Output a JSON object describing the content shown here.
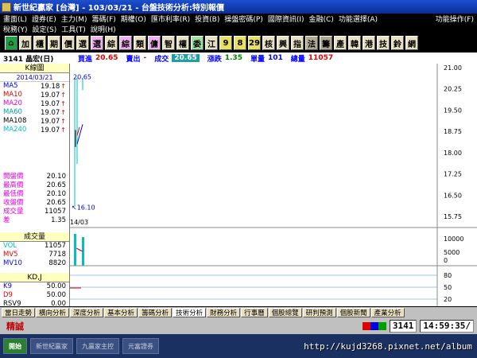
{
  "window": {
    "title": "新世紀贏家 [台灣] - 103/03/21 - 台盤技術分析:特別報價"
  },
  "menu": {
    "row1": [
      "畫面(L)",
      "證券(E)",
      "主力(M)",
      "籌碼(F)",
      "期權(O)",
      "匯市利率(R)",
      "投資(B)",
      "操盤密碼(P)",
      "國際資訊(I)",
      "金融(C)",
      "功能選擇(A)"
    ],
    "row1_right": "功能操作(F)",
    "row2": [
      "稅務(Y)",
      "設定(S)",
      "工具(T)",
      "說明(H)"
    ]
  },
  "toolbar": {
    "buttons": [
      {
        "label": "⌂",
        "style": "home"
      },
      {
        "label": "加",
        "style": ""
      },
      {
        "label": "櫃",
        "style": ""
      },
      {
        "label": "期",
        "style": ""
      },
      {
        "label": "價",
        "style": ""
      },
      {
        "label": "選",
        "style": ""
      },
      {
        "label": "選",
        "style": "pink"
      },
      {
        "label": "綜",
        "style": ""
      },
      {
        "label": "綜",
        "style": "pink"
      },
      {
        "label": "類",
        "style": ""
      },
      {
        "label": "傭",
        "style": "pink"
      },
      {
        "label": "智",
        "style": ""
      },
      {
        "label": "權",
        "style": ""
      },
      {
        "label": "委",
        "style": "green"
      },
      {
        "label": "江",
        "style": ""
      },
      {
        "label": "9",
        "style": "yellow"
      },
      {
        "label": "8",
        "style": "yellow"
      },
      {
        "label": "29",
        "style": "yellow"
      },
      {
        "label": "核",
        "style": ""
      },
      {
        "label": "興",
        "style": ""
      },
      {
        "label": "指",
        "style": ""
      },
      {
        "label": "法",
        "style": "gray"
      },
      {
        "label": "籌",
        "style": "gray"
      },
      {
        "label": "產",
        "style": ""
      },
      {
        "label": "韓",
        "style": ""
      },
      {
        "label": "港",
        "style": ""
      },
      {
        "label": "技",
        "style": ""
      },
      {
        "label": "鈴",
        "style": ""
      },
      {
        "label": "網",
        "style": ""
      }
    ]
  },
  "quote": {
    "symbol": "3141 晶宏(日)",
    "buy_label": "買進",
    "buy_value": "20.65",
    "sell_label": "賣出",
    "sell_value": "-",
    "deal_label": "成交",
    "deal_value": "20.65",
    "change_label": "漲跌",
    "change_value": "1.35",
    "volume_label": "單量",
    "volume_value": "101",
    "total_label": "總量",
    "total_value": "11057"
  },
  "side": {
    "kline_title": "K線圖",
    "date": "2014/03/21",
    "ma": [
      {
        "label": "MA5",
        "value": "19.18",
        "color": "#0000ff"
      },
      {
        "label": "MA10",
        "value": "19.07",
        "color": "#e00000"
      },
      {
        "label": "MA20",
        "value": "19.07",
        "color": "#e000e0"
      },
      {
        "label": "MA60",
        "value": "19.07",
        "color": "#00a0a0"
      },
      {
        "label": "MA108",
        "value": "19.07",
        "color": "#000000"
      },
      {
        "label": "MA240",
        "value": "19.07",
        "color": "#00c0c0"
      }
    ],
    "prices": [
      {
        "label": "開盤價",
        "value": "20.10"
      },
      {
        "label": "最高價",
        "value": "20.65"
      },
      {
        "label": "最低價",
        "value": "20.10"
      },
      {
        "label": "收盤價",
        "value": "20.65"
      },
      {
        "label": "成交量",
        "value": "11057"
      },
      {
        "label": "差",
        "value": "1.35"
      }
    ],
    "vol_title": "成交量",
    "vol": [
      {
        "label": "VOL",
        "value": "11057",
        "color": "#00c0c0"
      },
      {
        "label": "MV5",
        "value": "7718",
        "color": "#e00000"
      },
      {
        "label": "MV10",
        "value": "8820",
        "color": "#0000ff"
      }
    ],
    "kd_title": "KD,J",
    "kd": [
      {
        "label": "K9",
        "value": "50.00",
        "color": "#0000ff"
      },
      {
        "label": "D9",
        "value": "50.00",
        "color": "#e00000"
      },
      {
        "label": "RSV9",
        "value": "0.00",
        "color": "#000000"
      }
    ]
  },
  "chart_data": {
    "type": "candlestick",
    "price_axis": [
      "21.00",
      "20.25",
      "19.50",
      "18.75",
      "18.00",
      "17.25",
      "16.50",
      "15.75"
    ],
    "price_range": [
      15.75,
      21.0
    ],
    "high_label": "20.65",
    "low_label": "16.10",
    "date_label": "14/03",
    "vol_axis": [
      "10000",
      "5000",
      "0"
    ],
    "kd_axis": [
      "80",
      "50",
      "20"
    ]
  },
  "tabs": [
    "當日走勢",
    "橫向分析",
    "深度分析",
    "基本分析",
    "籌碼分析",
    "技術分析",
    "財務分析",
    "行事曆",
    "個股總覽",
    "研判預測",
    "個股新聞",
    "產業分析"
  ],
  "tabs_active": 5,
  "status": {
    "brand": "精誠",
    "code": "3141",
    "time": "14:59:35/"
  },
  "taskbar": {
    "items": [
      "開始",
      "新世紀贏家",
      "九贏家主控",
      "元富證券"
    ]
  },
  "watermark": "http://kujd3268.pixnet.net/album"
}
